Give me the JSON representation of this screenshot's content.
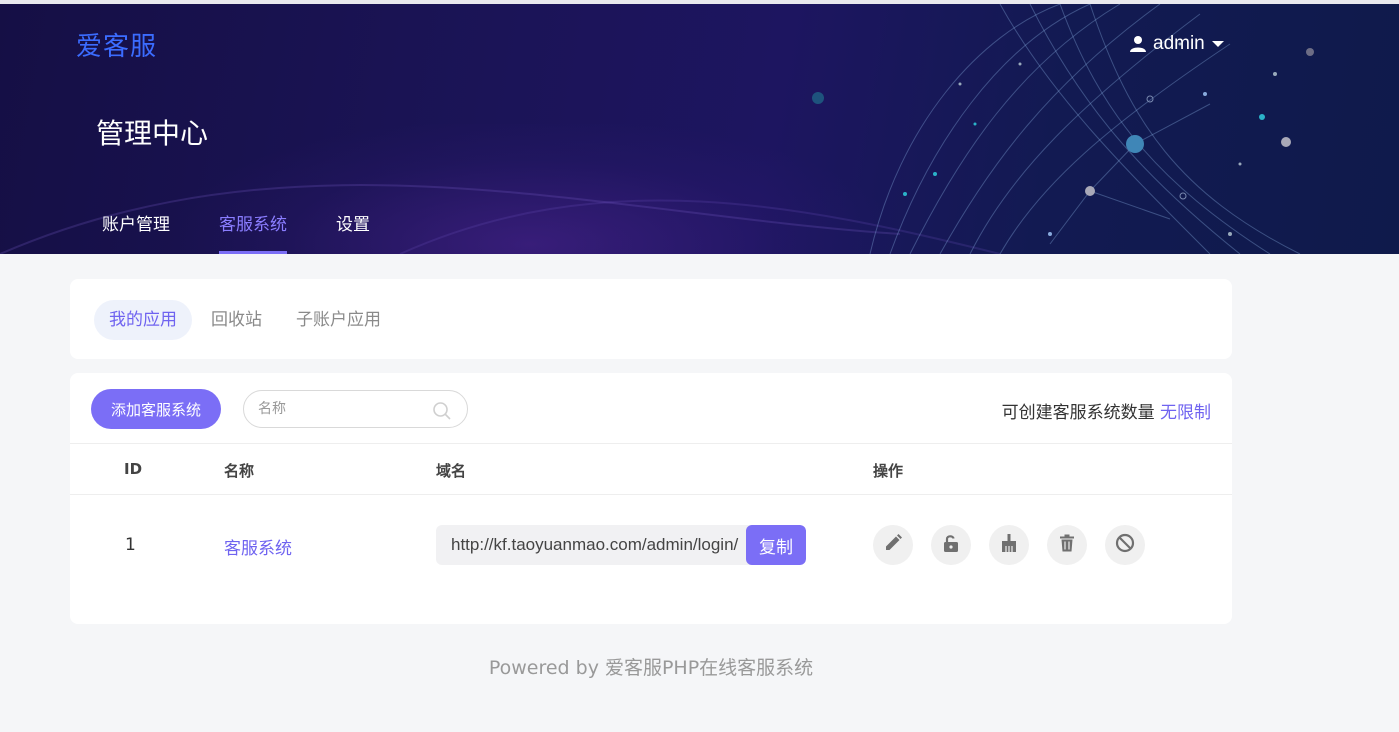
{
  "header": {
    "brand": "爱客服",
    "user": "admin",
    "title": "管理中心",
    "nav": [
      {
        "label": "账户管理"
      },
      {
        "label": "客服系统",
        "active": true
      },
      {
        "label": "设置"
      }
    ]
  },
  "subtabs": [
    {
      "label": "我的应用",
      "active": true
    },
    {
      "label": "回收站"
    },
    {
      "label": "子账户应用"
    }
  ],
  "toolbar": {
    "add_label": "添加客服系统",
    "search_placeholder": "名称",
    "quota_label": "可创建客服系统数量",
    "quota_value": "无限制"
  },
  "table": {
    "columns": [
      "ID",
      "名称",
      "域名",
      "操作"
    ],
    "rows": [
      {
        "id": "1",
        "name": "客服系统",
        "domain": "http://kf.taoyuanmao.com/admin/login/",
        "copy_label": "复制",
        "actions": [
          "edit-icon",
          "unlock-icon",
          "clean-icon",
          "delete-icon",
          "disable-icon"
        ]
      }
    ]
  },
  "footer": "Powered by 爱客服PHP在线客服系统",
  "colors": {
    "accent": "#7b6ef6",
    "brand": "#3b6cff",
    "header_bg": "#1b1457"
  }
}
